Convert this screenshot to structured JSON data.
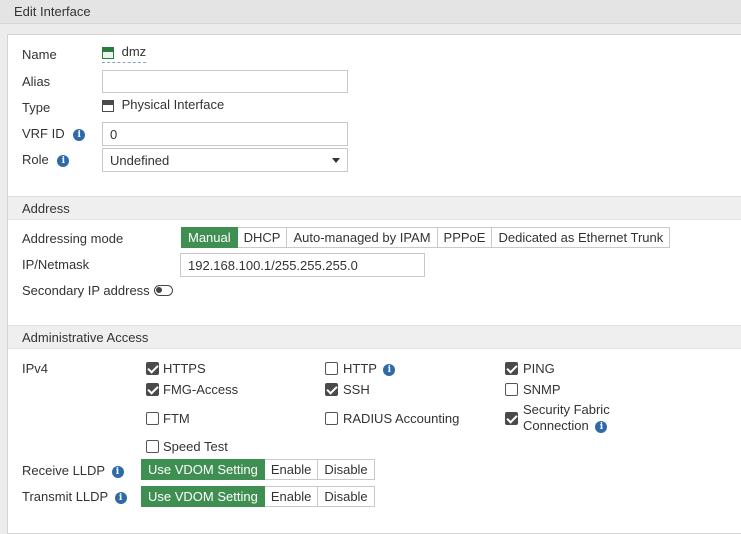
{
  "window": {
    "title": "Edit Interface"
  },
  "general": {
    "name_label": "Name",
    "name_value": "dmz",
    "alias_label": "Alias",
    "alias_value": "",
    "type_label": "Type",
    "type_value": "Physical Interface",
    "vrf_label": "VRF ID",
    "vrf_value": "0",
    "role_label": "Role",
    "role_value": "Undefined"
  },
  "address": {
    "section_title": "Address",
    "mode_label": "Addressing mode",
    "modes": [
      "Manual",
      "DHCP",
      "Auto-managed by IPAM",
      "PPPoE",
      "Dedicated as Ethernet Trunk"
    ],
    "selected_mode": "Manual",
    "ipmask_label": "IP/Netmask",
    "ipmask_value": "192.168.100.1/255.255.255.0",
    "secondary_label": "Secondary IP address",
    "secondary_enabled": false
  },
  "admin": {
    "section_title": "Administrative Access",
    "ipv4_label": "IPv4",
    "options": {
      "https": {
        "label": "HTTPS",
        "checked": true
      },
      "http": {
        "label": "HTTP",
        "checked": false
      },
      "ping": {
        "label": "PING",
        "checked": true
      },
      "fmg": {
        "label": "FMG-Access",
        "checked": true
      },
      "ssh": {
        "label": "SSH",
        "checked": true
      },
      "snmp": {
        "label": "SNMP",
        "checked": false
      },
      "ftm": {
        "label": "FTM",
        "checked": false
      },
      "radius": {
        "label": "RADIUS Accounting",
        "checked": false
      },
      "fabric": {
        "label_line1": "Security Fabric",
        "label_line2": "Connection",
        "checked": true
      },
      "speed": {
        "label": "Speed Test",
        "checked": false
      }
    }
  },
  "lldp": {
    "receive_label": "Receive LLDP",
    "transmit_label": "Transmit LLDP",
    "options": [
      "Use VDOM Setting",
      "Enable",
      "Disable"
    ],
    "receive_selected": "Use VDOM Setting",
    "transmit_selected": "Use VDOM Setting"
  },
  "icons": {
    "info": "info-icon",
    "interface": "interface-icon",
    "toggle": "toggle-off-icon"
  },
  "colors": {
    "accent_green": "#3f8f52",
    "info_blue": "#2f6aa6"
  }
}
